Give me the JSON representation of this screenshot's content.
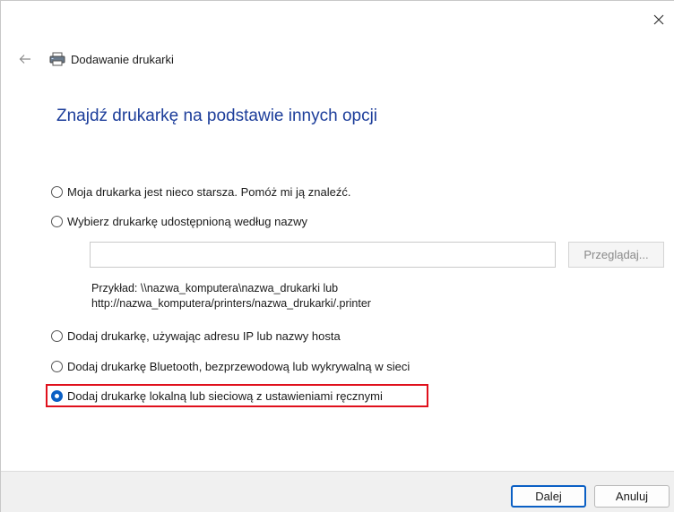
{
  "window": {
    "close_glyph": "✕"
  },
  "header": {
    "back_icon": "arrow-left-icon",
    "printer_icon": "printer-icon",
    "title": "Dodawanie drukarki"
  },
  "page": {
    "title": "Znajdź drukarkę na podstawie innych opcji"
  },
  "options": [
    {
      "label": "Moja drukarka jest nieco starsza. Pomóż mi ją znaleźć.",
      "checked": false
    },
    {
      "label": "Wybierz drukarkę udostępnioną według nazwy",
      "checked": false
    },
    {
      "label": "Dodaj drukarkę, używając adresu IP lub nazwy hosta",
      "checked": false
    },
    {
      "label": "Dodaj drukarkę Bluetooth, bezprzewodową lub wykrywalną w sieci",
      "checked": false
    },
    {
      "label": "Dodaj drukarkę lokalną lub sieciową z ustawieniami ręcznymi",
      "checked": true
    }
  ],
  "shared_printer": {
    "input_value": "",
    "browse_label": "Przeglądaj...",
    "example_line1": "Przykład: \\\\nazwa_komputera\\nazwa_drukarki lub",
    "example_line2": "http://nazwa_komputera/printers/nazwa_drukarki/.printer"
  },
  "footer": {
    "next_label": "Dalej",
    "cancel_label": "Anuluj"
  },
  "colors": {
    "title_blue": "#1c3d9a",
    "radio_selected": "#0a5fc4",
    "highlight_red": "#e0101c"
  }
}
